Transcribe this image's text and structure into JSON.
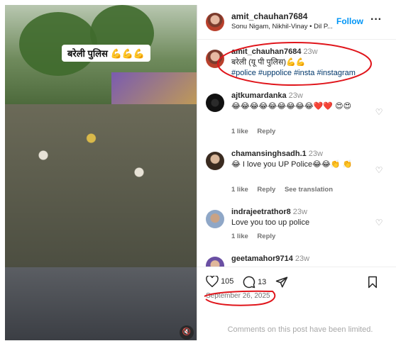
{
  "media": {
    "caption": "बरेली पुलिस 💪💪💪",
    "mute_icon": "speaker-muted-icon"
  },
  "header": {
    "username": "amit_chauhan7684",
    "subtitle": "Sonu Nigam, Nikhil-Vinay • Dil P...",
    "follow_label": "Follow",
    "more_icon": "ellipsis-icon"
  },
  "post_caption": {
    "username": "amit_chauhan7684",
    "time": "23w",
    "text": "बरेली (यू पी पुलिस)💪💪",
    "hashtags": "#police #uppolice #insta #instagram"
  },
  "comments": [
    {
      "username": "ajtkumardanka",
      "time": "23w",
      "text": "😂😂😂😂😂😂😂😂😂❤️❤️ 😍😍",
      "likes": "1 like",
      "reply": "Reply",
      "translate": ""
    },
    {
      "username": "chamansinghsadh.1",
      "time": "23w",
      "text": "😂 I love you UP Police😂😂👏 👏",
      "likes": "1 like",
      "reply": "Reply",
      "translate": "See translation"
    },
    {
      "username": "indrajeetrathor8",
      "time": "23w",
      "text": "Love you too up police",
      "likes": "1 like",
      "reply": "Reply",
      "translate": ""
    },
    {
      "username": "geetamahor9714",
      "time": "23w",
      "text": "",
      "likes": "",
      "reply": "",
      "translate": ""
    }
  ],
  "actions": {
    "like_count": "105",
    "comment_count": "13",
    "date": "September 26, 2025",
    "limited_text": "Comments on this post have been limited."
  },
  "colors": {
    "accent": "#0095f6",
    "annotation": "#e0151b"
  }
}
